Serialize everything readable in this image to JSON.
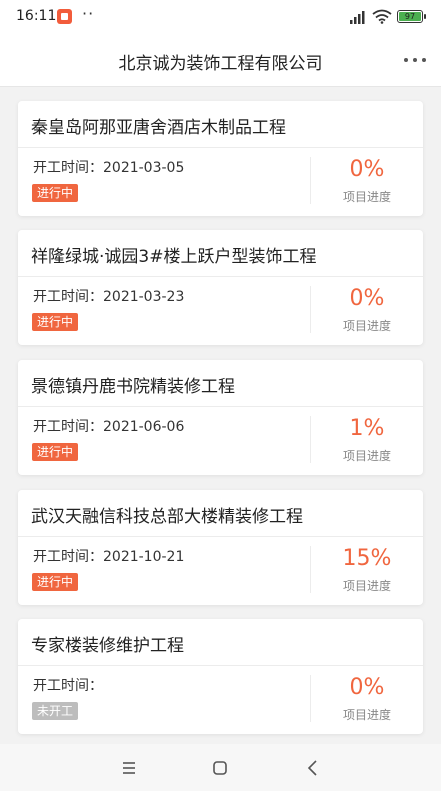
{
  "status_bar": {
    "time": "16:11",
    "dots": "··",
    "battery": "97",
    "icons": [
      "app-notification-icon",
      "signal-icon",
      "wifi-icon",
      "battery-icon"
    ]
  },
  "header": {
    "title": "北京诚为装饰工程有限公司",
    "more_icon": "more-icon"
  },
  "progress_label": "项目进度",
  "projects": [
    {
      "title": "秦皇岛阿那亚唐舍酒店木制品工程",
      "start_label": "开工时间：",
      "start_date": "2021-03-05",
      "status": "进行中",
      "progress": "0%"
    },
    {
      "title": "祥隆绿城·诚园3#楼上跃户型装饰工程",
      "start_label": "开工时间：",
      "start_date": "2021-03-23",
      "status": "进行中",
      "progress": "0%"
    },
    {
      "title": "景德镇丹鹿书院精装修工程",
      "start_label": "开工时间：",
      "start_date": "2021-06-06",
      "status": "进行中",
      "progress": "1%"
    },
    {
      "title": "武汉天融信科技总部大楼精装修工程",
      "start_label": "开工时间：",
      "start_date": "2021-10-21",
      "status": "进行中",
      "progress": "15%"
    },
    {
      "title": "专家楼装修维护工程",
      "start_label": "开工时间：",
      "start_date": "",
      "status": "未开工",
      "progress": "0%"
    }
  ],
  "colors": {
    "accent": "#f0663f",
    "pending_badge": "#bdbdbd",
    "background": "#f2f2f2"
  },
  "nav_bar": {
    "icons": [
      "menu-icon",
      "home-icon",
      "back-icon"
    ]
  }
}
